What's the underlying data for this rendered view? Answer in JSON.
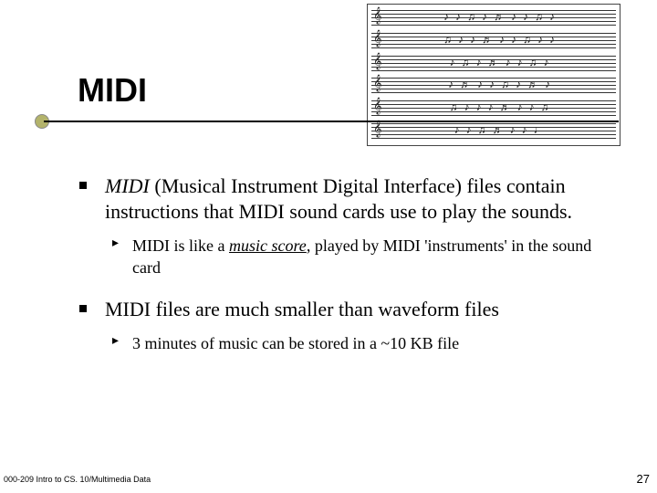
{
  "title": "MIDI",
  "bullets": [
    {
      "text_prefix_italic": "MIDI",
      "text_rest": " (Musical Instrument Digital Interface) files contain instructions that MIDI sound cards use to play the sounds.",
      "sub": {
        "prefix": "MIDI is like a ",
        "emph": "music score",
        "suffix": ", played by MIDI 'instruments' in the sound card"
      }
    },
    {
      "text": "MIDI files are much smaller than waveform files",
      "sub": {
        "full": "3 minutes of music can be stored in a ~10 KB file"
      }
    }
  ],
  "footer": {
    "left": "000-209 Intro to CS. 10/Multimedia Data",
    "right": "27"
  },
  "decor": {
    "clef": "𝄞"
  }
}
